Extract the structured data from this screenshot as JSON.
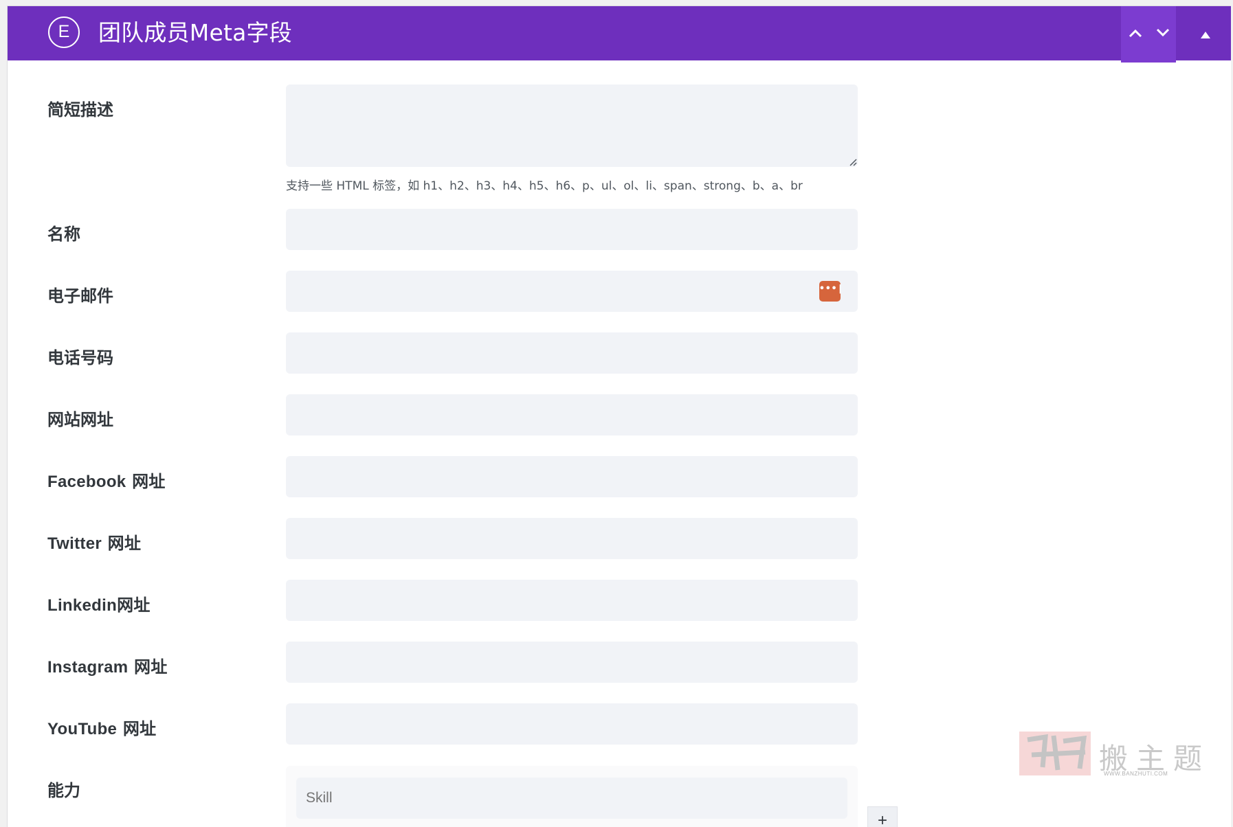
{
  "header": {
    "logo_letter": "E",
    "title": "团队成员Meta字段"
  },
  "fields": {
    "short_description": {
      "label": "简短描述",
      "value": ""
    },
    "hint": "支持一些 HTML 标签，如 h1、h2、h3、h4、h5、h6、p、ul、ol、li、span、strong、b、a、br",
    "name": {
      "label": "名称",
      "value": ""
    },
    "email": {
      "label": "电子邮件",
      "value": ""
    },
    "phone": {
      "label": "电话号码",
      "value": ""
    },
    "website": {
      "label": "网站网址",
      "value": ""
    },
    "facebook": {
      "label_prefix": "Facebook",
      "label_suffix": " 网址",
      "value": ""
    },
    "twitter": {
      "label_prefix": "Twitter",
      "label_suffix": " 网址",
      "value": ""
    },
    "linkedin": {
      "label_prefix": "Linkedin",
      "label_suffix": "网址",
      "value": ""
    },
    "instagram": {
      "label_prefix": "Instagram",
      "label_suffix": " 网址",
      "value": ""
    },
    "youtube": {
      "label_prefix": "YouTube",
      "label_suffix": " 网址",
      "value": ""
    },
    "skills": {
      "label": "能力",
      "placeholder": "Skill"
    }
  },
  "password_badge_text": "•••|",
  "add_button_label": "+",
  "watermark": {
    "zh": "搬主题",
    "url": "WWW.BANZHUTI.COM"
  },
  "colors": {
    "header_bg": "#6e2fbd",
    "field_bg": "#f1f3f7",
    "badge": "#d6653c"
  }
}
